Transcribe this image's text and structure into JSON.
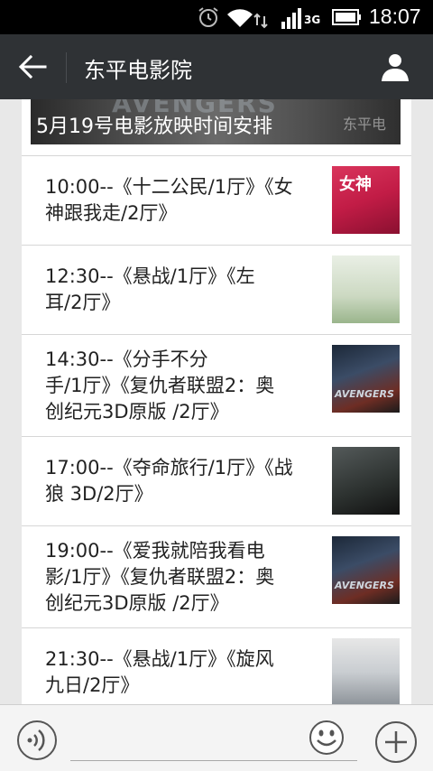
{
  "status_bar": {
    "network_type": "3G",
    "time": "18:07"
  },
  "header": {
    "title": "东平电影院",
    "back_icon": "back-arrow-icon",
    "user_icon": "user-icon"
  },
  "banner": {
    "title": "5月19号电影放映时间安排",
    "bg_text": "AVENGERS",
    "watermark": "东平电"
  },
  "schedule": [
    {
      "line1": "10:00--《十二公民/1厅》《女",
      "line2": "神跟我走/2厅》",
      "line3": ""
    },
    {
      "line1": "12:30--《悬战/1厅》《左",
      "line2": "耳/2厅》",
      "line3": ""
    },
    {
      "line1": "14:30--《分手不分",
      "line2": "手/1厅》《复仇者联盟2：奥",
      "line3": "创纪元3D原版 /2厅》"
    },
    {
      "line1": "17:00--《夺命旅行/1厅》《战",
      "line2": "狼 3D/2厅》",
      "line3": ""
    },
    {
      "line1": "19:00--《爱我就陪我看电",
      "line2": "影/1厅》《复仇者联盟2：奥",
      "line3": "创纪元3D原版 /2厅》"
    },
    {
      "line1": "21:30--《悬战/1厅》《旋风",
      "line2": "九日/2厅》",
      "line3": ""
    }
  ],
  "thumbs": {
    "t1": "女神",
    "t3": "AVENGERS",
    "t5": "AVENGERS"
  },
  "input_bar": {
    "placeholder": ""
  },
  "colors": {
    "status_bar": "#000000",
    "action_bar": "#2f3235",
    "background": "#e8e8e8",
    "card": "#ffffff"
  }
}
